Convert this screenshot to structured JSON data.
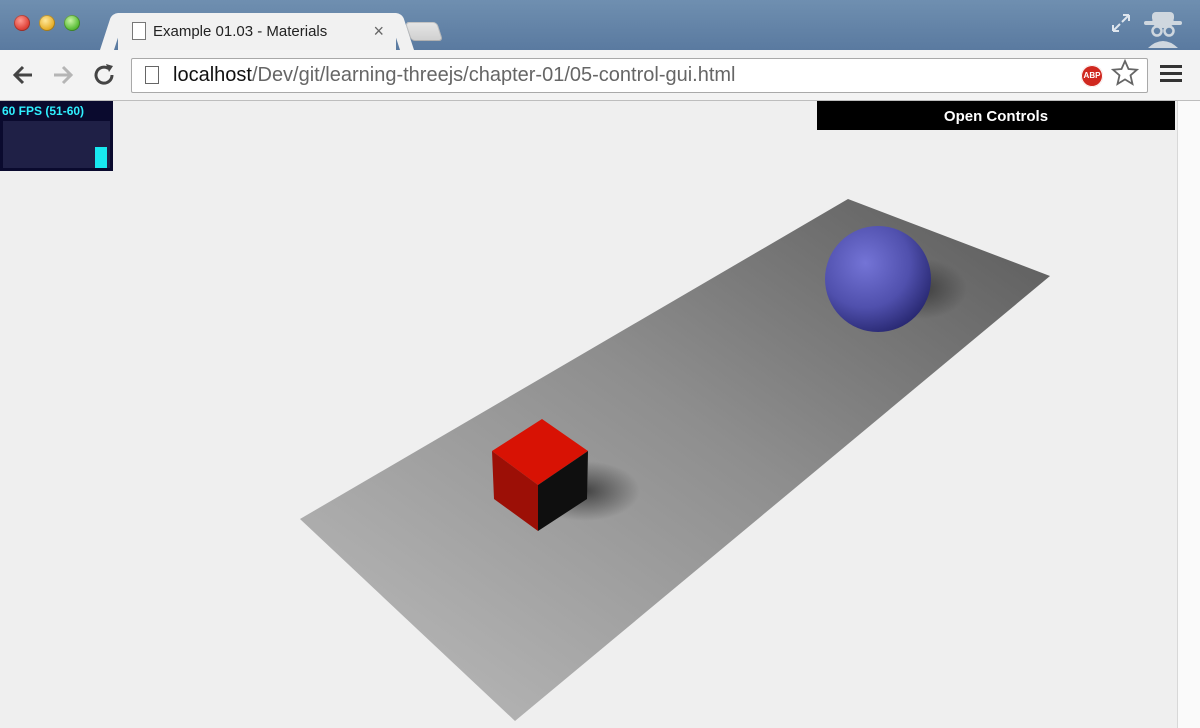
{
  "window": {
    "tab": {
      "title": "Example 01.03 - Materials",
      "close_glyph": "×",
      "icon": "document-icon"
    }
  },
  "toolbar": {
    "url_host": "localhost",
    "url_path": "/Dev/git/learning-threejs/chapter-01/05-control-gui.html",
    "abp_label": "ABP",
    "back_icon": "back-arrow-icon",
    "forward_icon": "forward-arrow-icon",
    "reload_icon": "reload-icon",
    "bookmark_icon": "star-icon",
    "menu_icon": "hamburger-menu-icon"
  },
  "page": {
    "stats": {
      "text": "60 FPS (51-60)",
      "fps_fill": 0.45
    },
    "controls": {
      "label": "Open Controls"
    },
    "scene": {
      "background_color": "#efefef",
      "plane_color": "#9a9a9a",
      "cube_color": "#d01008",
      "sphere_color": "#5a5ab8"
    }
  }
}
